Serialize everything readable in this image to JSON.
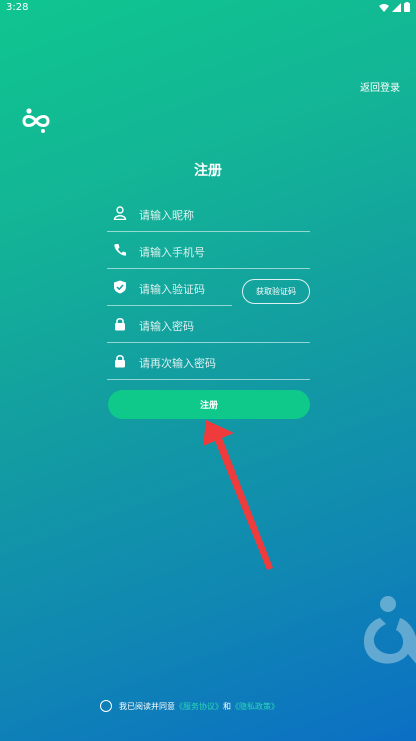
{
  "status_bar": {
    "time": "3:28"
  },
  "header": {
    "back_login": "返回登录"
  },
  "title": "注册",
  "form": {
    "nickname_placeholder": "请输入昵称",
    "phone_placeholder": "请输入手机号",
    "code_placeholder": "请输入验证码",
    "password_placeholder": "请输入密码",
    "confirm_placeholder": "请再次输入密码",
    "get_code_label": "获取验证码",
    "register_label": "注册"
  },
  "agreement": {
    "prefix": "我已阅读并同意",
    "service_link": "《服务协议》",
    "conjunction": "和",
    "privacy_link": "《隐私政策》"
  },
  "colors": {
    "accent": "#0fc98a",
    "link": "#2bd7b3",
    "arrow": "#ef3b3b"
  },
  "icons": [
    "user-icon",
    "phone-icon",
    "shield-icon",
    "lock-icon",
    "lock-icon"
  ]
}
